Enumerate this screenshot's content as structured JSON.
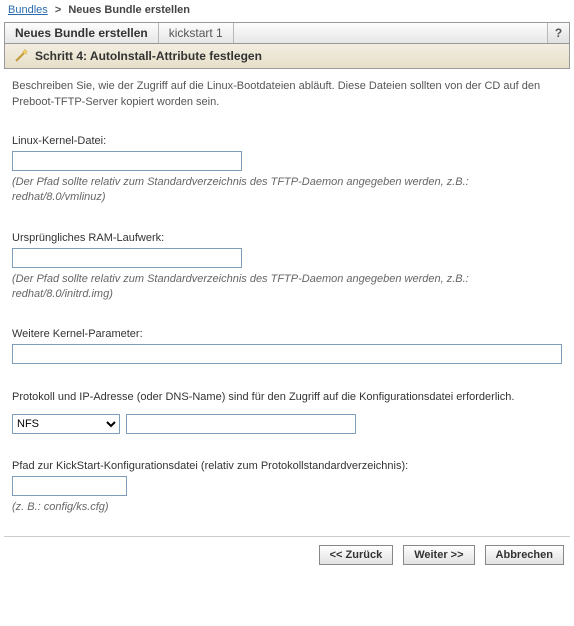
{
  "breadcrumb": {
    "link": "Bundles",
    "current": "Neues Bundle erstellen"
  },
  "titlebar": {
    "title": "Neues Bundle erstellen",
    "subtitle": "kickstart 1",
    "help": "?"
  },
  "step": {
    "label": "Schritt 4: AutoInstall-Attribute festlegen"
  },
  "desc": "Beschreiben Sie, wie der Zugriff auf die Linux-Bootdateien abläuft. Diese Dateien sollten von der CD auf den Preboot-TFTP-Server kopiert worden sein.",
  "fields": {
    "kernel": {
      "label": "Linux-Kernel-Datei:",
      "value": "",
      "hint": "(Der Pfad sollte relativ zum Standardverzeichnis des TFTP-Daemon angegeben werden, z.B.: redhat/8.0/vmlinuz)"
    },
    "ramdisk": {
      "label": "Ursprüngliches RAM-Laufwerk:",
      "value": "",
      "hint": "(Der Pfad sollte relativ zum Standardverzeichnis des TFTP-Daemon angegeben werden, z.B.: redhat/8.0/initrd.img)"
    },
    "kernelparams": {
      "label": "Weitere Kernel-Parameter:",
      "value": ""
    },
    "protocol": {
      "text": "Protokoll und IP-Adresse (oder DNS-Name) sind für den Zugriff auf die Konfigurationsdatei erforderlich.",
      "selected": "NFS",
      "address": ""
    },
    "kspath": {
      "label": "Pfad zur KickStart-Konfigurationsdatei (relativ zum Protokollstandardverzeichnis):",
      "value": "",
      "hint": "(z. B.: config/ks.cfg)"
    }
  },
  "buttons": {
    "back": "<< Zurück",
    "next": "Weiter >>",
    "cancel": "Abbrechen"
  }
}
